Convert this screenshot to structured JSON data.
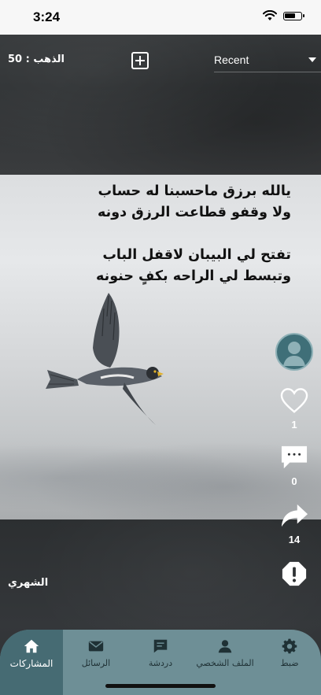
{
  "status_bar": {
    "time": "3:24"
  },
  "header": {
    "gold_label": "الذهب : 50",
    "sort": {
      "selected": "Recent"
    }
  },
  "post": {
    "poem_lines": [
      "يالله برزق ماحسبنا له حساب",
      "ولا وقفو قطاعت الرزق دونه",
      "تفتح لي البيبان لاقفل الباب",
      "وتبسط لي الراحه بكفٍ حنونه"
    ],
    "author": "الشهري",
    "likes": "1",
    "comments": "0",
    "shares": "14"
  },
  "tabs": [
    {
      "label": "المشاركات",
      "icon": "home-icon"
    },
    {
      "label": "الرسائل",
      "icon": "mail-icon"
    },
    {
      "label": "دردشة",
      "icon": "chat-icon"
    },
    {
      "label": "الملف الشخصي",
      "icon": "person-icon"
    },
    {
      "label": "ضبط",
      "icon": "gear-icon"
    }
  ],
  "colors": {
    "tab_bar": "#6e8f96",
    "tab_active": "#466b73",
    "avatar": "#3f6f78"
  }
}
